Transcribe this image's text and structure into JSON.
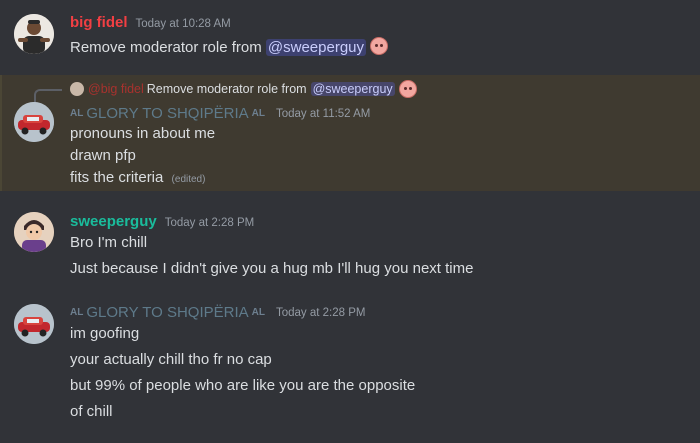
{
  "messages": {
    "m1": {
      "username": "big fidel",
      "timestamp": "Today at 10:28 AM",
      "text": "Remove moderator role from",
      "mention": "@sweeperguy",
      "username_color": "#f23f43"
    },
    "m2": {
      "reply": {
        "username": "@big fidel",
        "text": "Remove moderator role from",
        "mention": "@sweeperguy"
      },
      "tag_left": "AL",
      "username": "GLORY TO SHQIPËRIA",
      "tag_right": "AL",
      "timestamp": "Today at 11:52 AM",
      "lines": [
        "pronouns in about me",
        "drawn pfp",
        "fits the criteria"
      ],
      "edited": "(edited)",
      "username_color": "#5e7a8a"
    },
    "m3": {
      "username": "sweeperguy",
      "timestamp": "Today at 2:28 PM",
      "lines": [
        "Bro I'm chill",
        "Just because I didn't give you a hug mb I'll hug you next time"
      ],
      "username_color": "#1abc9c"
    },
    "m4": {
      "tag_left": "AL",
      "username": "GLORY TO SHQIPËRIA",
      "tag_right": "AL",
      "timestamp": "Today at 2:28 PM",
      "lines": [
        "im goofing",
        "your actually chill tho fr no cap",
        "but 99% of people who are like you are the opposite",
        "of chill"
      ]
    }
  },
  "colors": {
    "background": "#313338",
    "highlight": "#3f3a30",
    "mention_bg": "#3c4270"
  }
}
